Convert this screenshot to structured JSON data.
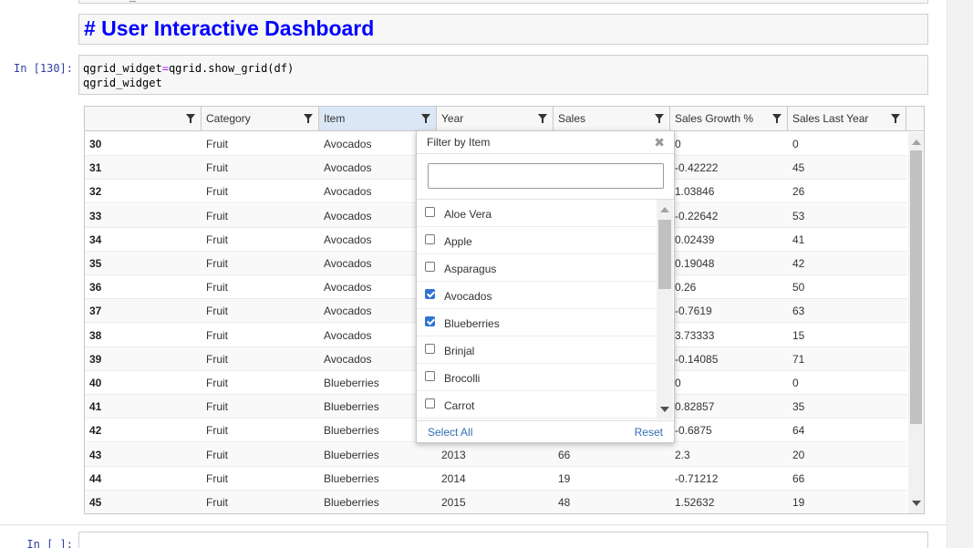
{
  "colors": {
    "heading": "#0000ff",
    "prompt": "#303f9f",
    "link": "#2f6fb5",
    "checkbox_checked": "#2f74d0",
    "active_header": "#dce7f5"
  },
  "previous_cell": {
    "text": "version_info"
  },
  "markdown_cell": {
    "heading": "# User Interactive Dashboard"
  },
  "code_cell": {
    "prompt": "In [130]:",
    "line1_a": "qgrid_widget",
    "line1_eq": "=",
    "line1_b": "qgrid.show_grid(df)",
    "line2": "qgrid_widget"
  },
  "grid": {
    "columns": [
      {
        "label": "",
        "icon": "filter-icon"
      },
      {
        "label": "Category",
        "icon": "filter-icon"
      },
      {
        "label": "Item",
        "icon": "filter-icon",
        "active": true
      },
      {
        "label": "Year",
        "icon": "filter-icon"
      },
      {
        "label": "Sales",
        "icon": "filter-icon"
      },
      {
        "label": "Sales Growth %",
        "icon": "filter-icon"
      },
      {
        "label": "Sales Last Year",
        "icon": "filter-icon"
      }
    ],
    "rows": [
      [
        "30",
        "Fruit",
        "Avocados",
        "",
        "",
        "0",
        "0"
      ],
      [
        "31",
        "Fruit",
        "Avocados",
        "",
        "",
        "-0.42222",
        "45"
      ],
      [
        "32",
        "Fruit",
        "Avocados",
        "",
        "",
        "1.03846",
        "26"
      ],
      [
        "33",
        "Fruit",
        "Avocados",
        "",
        "",
        "-0.22642",
        "53"
      ],
      [
        "34",
        "Fruit",
        "Avocados",
        "",
        "",
        "0.02439",
        "41"
      ],
      [
        "35",
        "Fruit",
        "Avocados",
        "",
        "",
        "0.19048",
        "42"
      ],
      [
        "36",
        "Fruit",
        "Avocados",
        "",
        "",
        "0.26",
        "50"
      ],
      [
        "37",
        "Fruit",
        "Avocados",
        "",
        "",
        "-0.7619",
        "63"
      ],
      [
        "38",
        "Fruit",
        "Avocados",
        "",
        "",
        "3.73333",
        "15"
      ],
      [
        "39",
        "Fruit",
        "Avocados",
        "",
        "",
        "-0.14085",
        "71"
      ],
      [
        "40",
        "Fruit",
        "Blueberries",
        "",
        "",
        "0",
        "0"
      ],
      [
        "41",
        "Fruit",
        "Blueberries",
        "",
        "",
        "0.82857",
        "35"
      ],
      [
        "42",
        "Fruit",
        "Blueberries",
        "",
        "",
        "-0.6875",
        "64"
      ],
      [
        "43",
        "Fruit",
        "Blueberries",
        "2013",
        "66",
        "2.3",
        "20"
      ],
      [
        "44",
        "Fruit",
        "Blueberries",
        "2014",
        "19",
        "-0.71212",
        "66"
      ],
      [
        "45",
        "Fruit",
        "Blueberries",
        "2015",
        "48",
        "1.52632",
        "19"
      ]
    ]
  },
  "filter_popup": {
    "title": "Filter by Item",
    "close_icon": "close-icon",
    "search_value": "",
    "options": [
      {
        "label": "Aloe Vera",
        "checked": false
      },
      {
        "label": "Apple",
        "checked": false
      },
      {
        "label": "Asparagus",
        "checked": false
      },
      {
        "label": "Avocados",
        "checked": true
      },
      {
        "label": "Blueberries",
        "checked": true
      },
      {
        "label": "Brinjal",
        "checked": false
      },
      {
        "label": "Brocolli",
        "checked": false
      },
      {
        "label": "Carrot",
        "checked": false
      }
    ],
    "select_all": "Select All",
    "reset": "Reset"
  },
  "next_cell": {
    "prompt": "In [ ]:"
  }
}
